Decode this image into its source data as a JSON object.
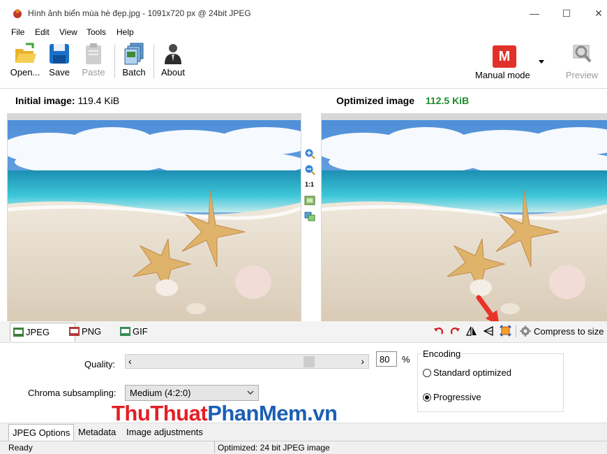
{
  "window": {
    "title": "Hình ảnh biển mùa hè đẹp.jpg - 1091x720 px @ 24bit JPEG",
    "min_glyph": "—",
    "max_glyph": "☐",
    "close_glyph": "✕"
  },
  "menu": [
    "File",
    "Edit",
    "View",
    "Tools",
    "Help"
  ],
  "toolbar": {
    "open": "Open...",
    "save": "Save",
    "paste": "Paste",
    "batch": "Batch",
    "about": "About",
    "mode_letter": "M",
    "mode": "Manual mode",
    "preview": "Preview"
  },
  "initial": {
    "label": "Initial image:",
    "size": "119.4 KiB"
  },
  "optimized": {
    "label": "Optimized image",
    "size": "112.5 KiB"
  },
  "zoom": {
    "one_to_one": "1:1"
  },
  "formats": [
    "JPEG",
    "PNG",
    "GIF"
  ],
  "tools": {
    "compress": "Compress to size"
  },
  "options": {
    "quality_label": "Quality:",
    "quality_value": "80",
    "quality_level": 0.8,
    "percent": "%",
    "arrow_left": "‹",
    "arrow_right": "›",
    "chroma_label": "Chroma subsampling:",
    "chroma_value": "Medium (4:2:0)",
    "encoding_title": "Encoding",
    "encoding_options": [
      "Standard optimized",
      "Progressive"
    ],
    "encoding_selected": "Progressive"
  },
  "watermark": {
    "part1": "ThuThuat",
    "part2": "PhanMem",
    "part3": ".vn"
  },
  "bottom_tabs": [
    "JPEG Options",
    "Metadata",
    "Image adjustments"
  ],
  "status": {
    "left": "Ready",
    "right": "Optimized: 24 bit JPEG image"
  },
  "colors": {
    "accent_green": "#1e8c2a",
    "mode_red": "#e0322a",
    "watermark_red": "#e41e26",
    "watermark_blue": "#1a5fb4"
  },
  "icons": [
    "app-icon",
    "open-folder-icon",
    "save-disk-icon",
    "paste-icon",
    "batch-icon",
    "about-user-icon",
    "preview-magnifier-icon",
    "zoom-in-icon",
    "zoom-out-icon",
    "fit-icon",
    "compare-icon",
    "rotate-left-icon",
    "rotate-right-icon",
    "flip-icon",
    "mirror-icon",
    "crop-icon",
    "gear-icon"
  ]
}
